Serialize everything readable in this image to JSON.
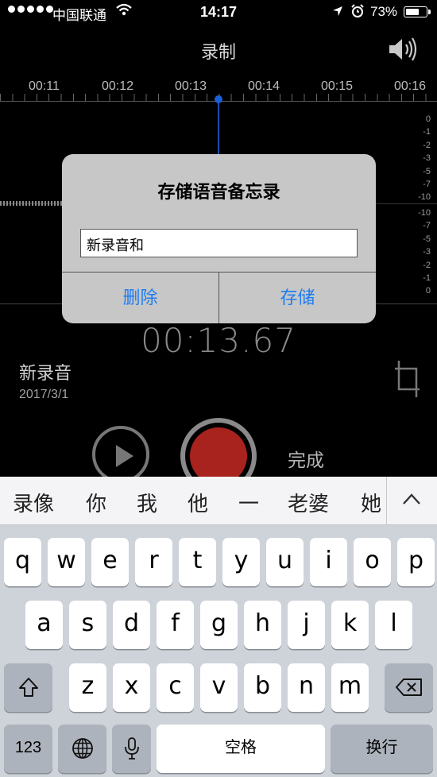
{
  "status": {
    "carrier": "中国联通",
    "time": "14:17",
    "battery": "73%",
    "battery_level": 0.73
  },
  "nav": {
    "title": "录制"
  },
  "timeline": {
    "labels": [
      "00:11",
      "00:12",
      "00:13",
      "00:14",
      "00:15",
      "00:16"
    ]
  },
  "scale": {
    "top": [
      "0",
      "-1",
      "-2",
      "-3",
      "-5",
      "-7",
      "-10"
    ],
    "bottom": [
      "-10",
      "-7",
      "-5",
      "-3",
      "-2",
      "-1",
      "0"
    ]
  },
  "recording": {
    "time": "00:13.67",
    "name": "新录音",
    "date": "2017/3/1",
    "done_label": "完成"
  },
  "dialog": {
    "title": "存储语音备忘录",
    "input_value": "新录音和",
    "delete_label": "删除",
    "save_label": "存储"
  },
  "suggestions": [
    "录像",
    "你",
    "我",
    "他",
    "一",
    "老婆",
    "她"
  ],
  "keyboard": {
    "row1": [
      "q",
      "w",
      "e",
      "r",
      "t",
      "y",
      "u",
      "i",
      "o",
      "p"
    ],
    "row2": [
      "a",
      "s",
      "d",
      "f",
      "g",
      "h",
      "j",
      "k",
      "l"
    ],
    "row3": [
      "z",
      "x",
      "c",
      "v",
      "b",
      "n",
      "m"
    ],
    "numbers_label": "123",
    "space_label": "空格",
    "return_label": "换行"
  },
  "colors": {
    "accent": "#1e7cf2",
    "record": "#a8231e",
    "playhead": "#1a5fd6"
  }
}
